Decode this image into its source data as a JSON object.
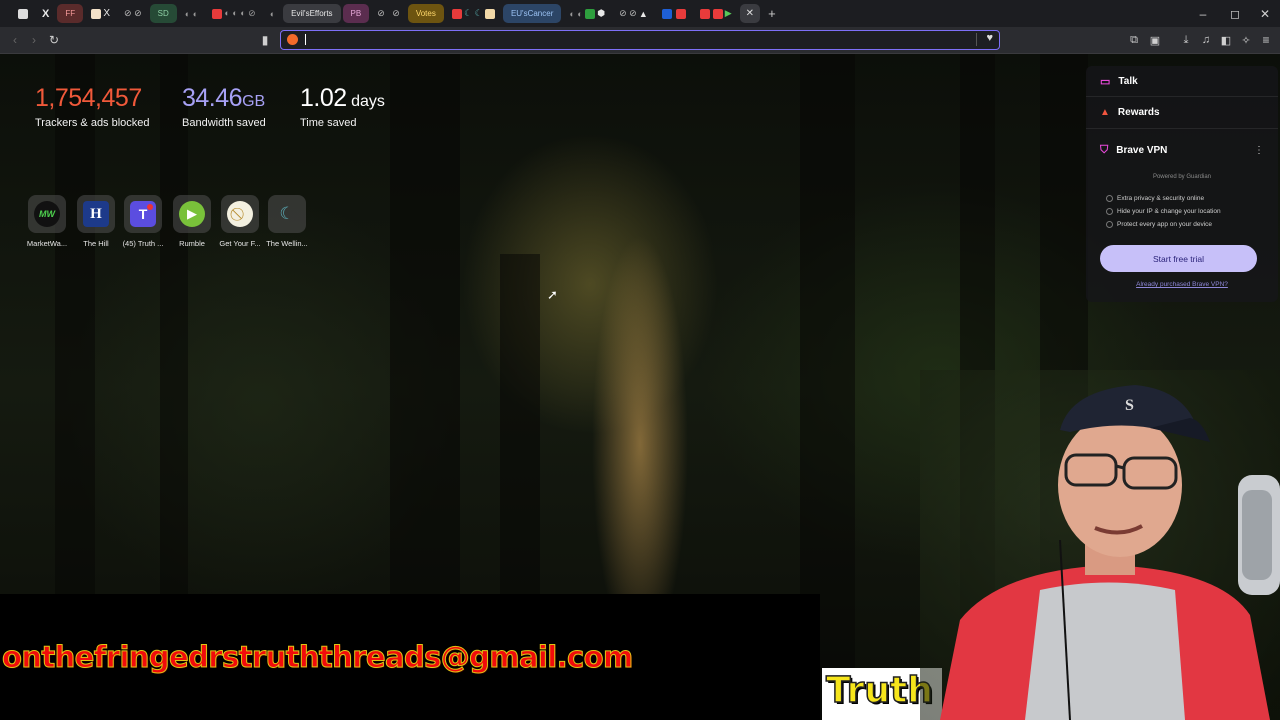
{
  "tabs": {
    "labeled": [
      "FF",
      "SD",
      "Evil'sEfforts",
      "PB",
      "Votes",
      "EU'sCancer"
    ],
    "new_tab_label": "+"
  },
  "stats": {
    "trackers": {
      "value": "1,754,457",
      "label": "Trackers & ads blocked",
      "color": "#f0593a"
    },
    "bandwidth": {
      "value": "34.46",
      "unit": "GB",
      "label": "Bandwidth saved",
      "color": "#a7a1f5"
    },
    "time": {
      "value": "1.02",
      "unit": "days",
      "label": "Time saved",
      "color": "#ffffff"
    }
  },
  "top_sites": [
    {
      "name": "MarketWa...",
      "icon": "marketwatch-icon",
      "glyph": "MW"
    },
    {
      "name": "The Hill",
      "icon": "the-hill-icon",
      "glyph": "H"
    },
    {
      "name": "(45) Truth ...",
      "icon": "truth-social-icon",
      "glyph": "T"
    },
    {
      "name": "Rumble",
      "icon": "rumble-icon",
      "glyph": "▶"
    },
    {
      "name": "Get Your F...",
      "icon": "site-icon",
      "glyph": "⃠"
    },
    {
      "name": "The Wellin...",
      "icon": "wellness-icon",
      "glyph": "☾"
    }
  ],
  "widget": {
    "talk": "Talk",
    "rewards": "Rewards",
    "vpn_title": "Brave VPN",
    "powered_by": "Powered by Guardian",
    "features": [
      "Extra privacy & security online",
      "Hide your IP & change your location",
      "Protect every app on your device"
    ],
    "trial_button": "Start free trial",
    "purchased_link": "Already purchased Brave VPN?"
  },
  "overlay": {
    "email": "onthefringedrstruththreads@gmail.com",
    "truth_text": "Truth"
  },
  "colors": {
    "accent": "#7d6ff7",
    "trial_button": "#c7c0f9"
  }
}
